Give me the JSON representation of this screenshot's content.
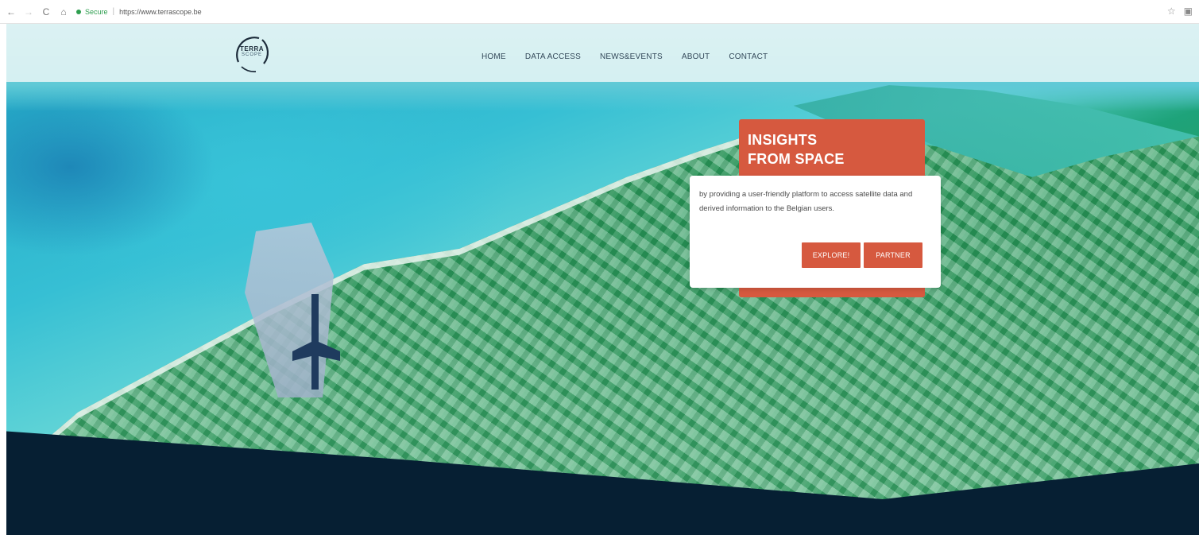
{
  "browser": {
    "back_icon": "←",
    "forward_icon": "→",
    "reload_icon": "C",
    "home_icon": "⌂",
    "secure_label": "Secure",
    "url": "https://www.terrascope.be",
    "star_icon": "☆",
    "menu_icon": "▣"
  },
  "site": {
    "logo_text": "TERRA",
    "logo_sub": "SCOPE",
    "nav": [
      {
        "label": "HOME"
      },
      {
        "label": "DATA ACCESS"
      },
      {
        "label": "NEWS&EVENTS"
      },
      {
        "label": "ABOUT"
      },
      {
        "label": "CONTACT"
      }
    ]
  },
  "hero": {
    "title_line1": "INSIGHTS",
    "title_line2": "FROM SPACE",
    "description": "by providing a user-friendly platform to access satellite data and derived information to the Belgian users.",
    "explore_label": "EXPLORE!",
    "partner_label": "PARTNER"
  },
  "colors": {
    "accent": "#d6593f",
    "navy": "#061f33",
    "nav_text": "#34495a"
  }
}
